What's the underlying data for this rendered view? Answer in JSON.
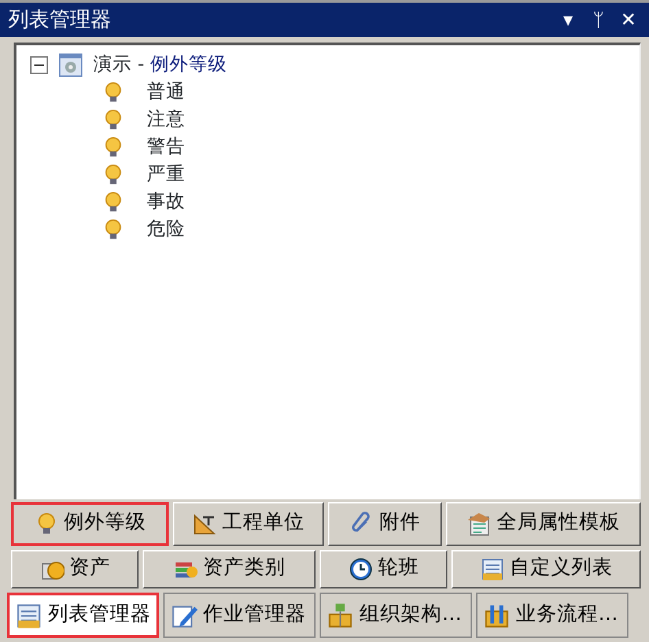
{
  "window": {
    "title": "列表管理器",
    "controls": [
      "▾",
      "ᛘ",
      "✕"
    ]
  },
  "tree": {
    "root": {
      "prefix": "演示 -",
      "label": "例外等级",
      "expanded": true,
      "children": [
        {
          "label": "普通"
        },
        {
          "label": "注意"
        },
        {
          "label": "警告"
        },
        {
          "label": "严重"
        },
        {
          "label": "事故"
        },
        {
          "label": "危险"
        }
      ]
    }
  },
  "buttons": [
    [
      {
        "label": "例外等级",
        "kind": "bulb",
        "selected": true
      },
      {
        "label": "工程单位",
        "kind": "ruler",
        "selected": false
      },
      {
        "label": "附件",
        "kind": "clip",
        "selected": false
      },
      {
        "label": "全局属性模板",
        "kind": "template",
        "selected": false
      }
    ],
    [
      {
        "label": "资产",
        "kind": "asset",
        "selected": false
      },
      {
        "label": "资产类别",
        "kind": "books",
        "selected": false
      },
      {
        "label": "轮班",
        "kind": "clock",
        "selected": false
      },
      {
        "label": "自定义列表",
        "kind": "list",
        "selected": false
      }
    ]
  ],
  "tabs": [
    {
      "label": "列表管理器",
      "kind": "list",
      "selected": true
    },
    {
      "label": "作业管理器",
      "kind": "pen",
      "selected": false
    },
    {
      "label": "组织架构…",
      "kind": "org",
      "selected": false
    },
    {
      "label": "业务流程…",
      "kind": "flow",
      "selected": false
    }
  ]
}
